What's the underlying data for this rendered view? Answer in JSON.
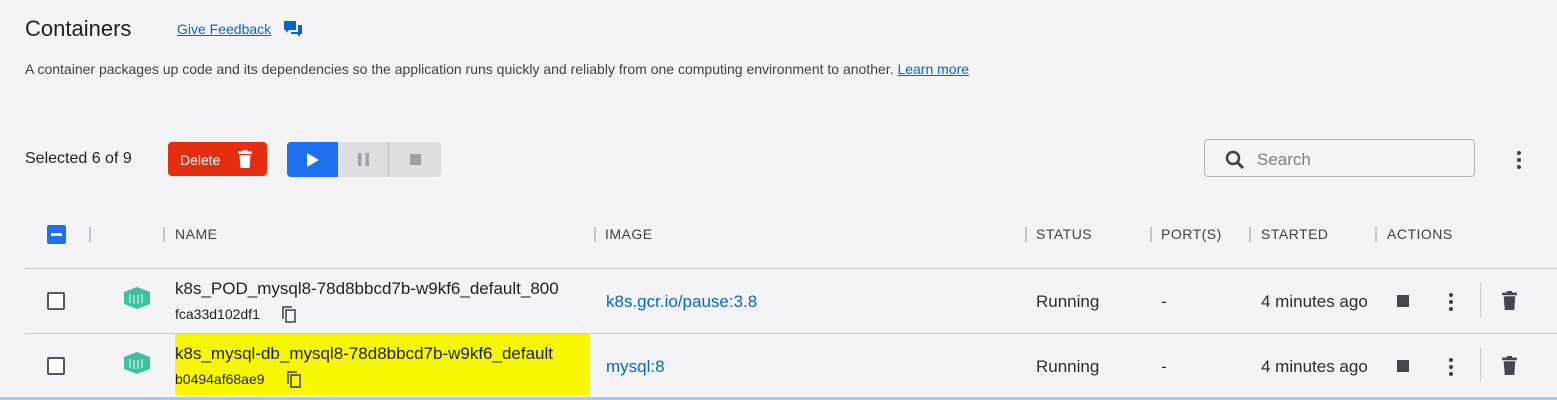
{
  "header": {
    "title": "Containers",
    "feedback_link": "Give Feedback",
    "description": "A container packages up code and its dependencies so the application runs quickly and reliably from one computing environment to another.",
    "learn_more": "Learn more"
  },
  "toolbar": {
    "selected_text": "Selected 6 of 9",
    "delete_label": "Delete",
    "search_placeholder": "Search"
  },
  "table": {
    "columns": [
      "NAME",
      "IMAGE",
      "STATUS",
      "PORT(S)",
      "STARTED",
      "ACTIONS"
    ],
    "rows": [
      {
        "name": "k8s_POD_mysql8-78d8bbcd7b-w9kf6_default_800",
        "id": "fca33d102df1",
        "image": "k8s.gcr.io/pause:3.8",
        "status": "Running",
        "ports": "-",
        "started": "4 minutes ago",
        "checked": false,
        "highlighted": false
      },
      {
        "name": "k8s_mysql-db_mysql8-78d8bbcd7b-w9kf6_default",
        "id": "b0494af68ae9",
        "image": "mysql:8",
        "status": "Running",
        "ports": "-",
        "started": "4 minutes ago",
        "checked": false,
        "highlighted": true
      }
    ]
  },
  "icons": {
    "feedback": "chat-bubbles-icon",
    "delete": "trash-icon",
    "play": "play-icon",
    "pause": "pause-icon",
    "stop": "stop-icon",
    "search": "magnifier-icon",
    "more": "vertical-dots-icon",
    "container": "container-cube-icon",
    "copy": "copy-icon"
  },
  "colors": {
    "accent": "#1d71ef",
    "danger": "#e32f10",
    "link": "#0964c8",
    "container_icon": "#3ec0a0",
    "highlight": "#f7f700"
  }
}
